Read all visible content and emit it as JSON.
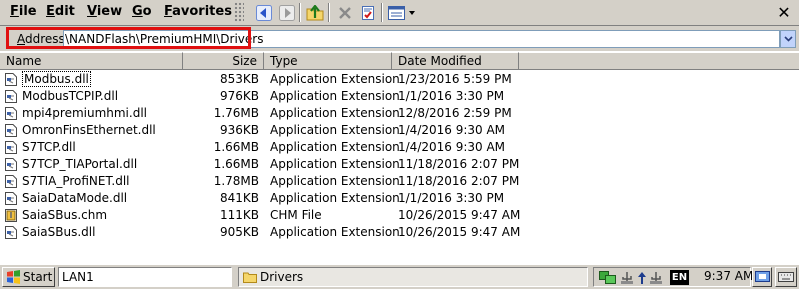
{
  "menu": {
    "file": {
      "ul": "F",
      "rest": "ile"
    },
    "edit": {
      "ul": "E",
      "rest": "dit"
    },
    "view": {
      "ul": "V",
      "rest": "iew"
    },
    "go": {
      "ul": "G",
      "rest": "o"
    },
    "favorites": {
      "ul": "F",
      "rest": "avorites"
    }
  },
  "toolbar": {
    "icons": [
      "back-icon",
      "forward-icon",
      "up-folder-icon",
      "delete-icon",
      "properties-icon",
      "views-icon",
      "close-icon"
    ],
    "close_glyph": "✕"
  },
  "address": {
    "label_ul": "A",
    "label_rest": "ddress",
    "value": "\\NANDFlash\\PremiumHMI\\Drivers",
    "highlight_color": "#e01010"
  },
  "columns": {
    "name": "Name",
    "size": "Size",
    "type": "Type",
    "date": "Date Modified"
  },
  "files": [
    {
      "name": "Modbus.dll",
      "size": "853KB",
      "type": "Application Extension",
      "date": "1/23/2016 5:59 PM",
      "focused": true
    },
    {
      "name": "ModbusTCPIP.dll",
      "size": "976KB",
      "type": "Application Extension",
      "date": "1/1/2016 3:30 PM"
    },
    {
      "name": "mpi4premiumhmi.dll",
      "size": "1.76MB",
      "type": "Application Extension",
      "date": "12/8/2016 2:59 PM"
    },
    {
      "name": "OmronFinsEthernet.dll",
      "size": "936KB",
      "type": "Application Extension",
      "date": "1/4/2016 9:30 AM"
    },
    {
      "name": "S7TCP.dll",
      "size": "1.66MB",
      "type": "Application Extension",
      "date": "1/4/2016 9:30 AM"
    },
    {
      "name": "S7TCP_TIAPortal.dll",
      "size": "1.66MB",
      "type": "Application Extension",
      "date": "11/18/2016 2:07 PM"
    },
    {
      "name": "S7TIA_ProfiNET.dll",
      "size": "1.78MB",
      "type": "Application Extension",
      "date": "11/18/2016 2:07 PM"
    },
    {
      "name": "SaiaDataMode.dll",
      "size": "841KB",
      "type": "Application Extension",
      "date": "1/1/2016 3:30 PM"
    },
    {
      "name": "SaiaSBus.chm",
      "size": "111KB",
      "type": "CHM File",
      "date": "10/26/2015 9:47 AM"
    },
    {
      "name": "SaiaSBus.dll",
      "size": "905KB",
      "type": "Application Extension",
      "date": "10/26/2015 9:47 AM"
    }
  ],
  "taskbar": {
    "start": "Start",
    "address_value": "LAN1",
    "window_title": "Drivers",
    "lang": "EN",
    "clock": "9:37 AM"
  }
}
